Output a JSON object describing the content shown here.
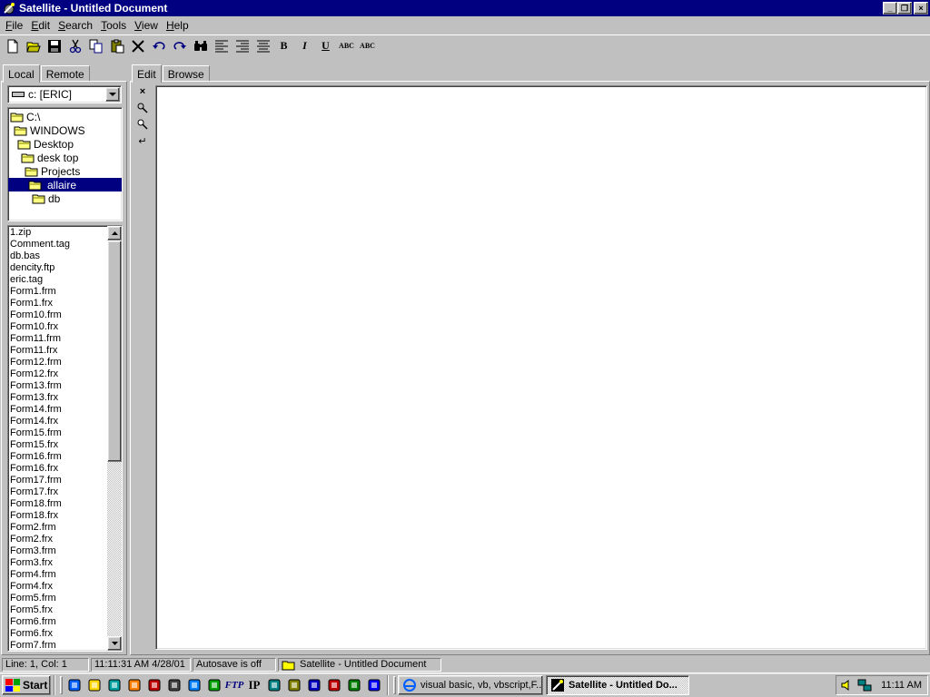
{
  "window": {
    "title": "Satellite - Untitled Document",
    "minimize_label": "_",
    "restore_label": "❐",
    "close_label": "×"
  },
  "menu": [
    {
      "label": "File",
      "hotkey": "F"
    },
    {
      "label": "Edit",
      "hotkey": "E"
    },
    {
      "label": "Search",
      "hotkey": "S"
    },
    {
      "label": "Tools",
      "hotkey": "T"
    },
    {
      "label": "View",
      "hotkey": "V"
    },
    {
      "label": "Help",
      "hotkey": "H"
    }
  ],
  "toolbar": {
    "buttons": [
      "new-icon",
      "open-icon",
      "save-icon",
      "cut-icon",
      "copy-icon",
      "paste-icon",
      "delete-icon",
      "undo-icon",
      "redo-icon",
      "find-icon",
      "align-left-icon",
      "align-right-icon",
      "align-center-icon",
      "bold-icon",
      "italic-icon",
      "underline-icon",
      "spellcheck-icon",
      "spellcheck-all-icon"
    ],
    "bold": "B",
    "italic": "I",
    "underline": "U",
    "spell1": "ABC",
    "spell2": "ABC"
  },
  "left_panel": {
    "tabs": [
      "Local",
      "Remote"
    ],
    "active_tab": "Local",
    "drive": "c: [ERIC]",
    "folders": [
      {
        "label": "C:\\",
        "indent": 0,
        "selected": false
      },
      {
        "label": "WINDOWS",
        "indent": 1,
        "selected": false
      },
      {
        "label": "Desktop",
        "indent": 2,
        "selected": false
      },
      {
        "label": "desk top",
        "indent": 3,
        "selected": false
      },
      {
        "label": "Projects",
        "indent": 4,
        "selected": false
      },
      {
        "label": "allaire",
        "indent": 5,
        "selected": true
      },
      {
        "label": "db",
        "indent": 6,
        "selected": false
      }
    ],
    "files": [
      "1.zip",
      "Comment.tag",
      "db.bas",
      "dencity.ftp",
      "eric.tag",
      "Form1.frm",
      "Form1.frx",
      "Form10.frm",
      "Form10.frx",
      "Form11.frm",
      "Form11.frx",
      "Form12.frm",
      "Form12.frx",
      "Form13.frm",
      "Form13.frx",
      "Form14.frm",
      "Form14.frx",
      "Form15.frm",
      "Form15.frx",
      "Form16.frm",
      "Form16.frx",
      "Form17.frm",
      "Form17.frx",
      "Form18.frm",
      "Form18.frx",
      "Form2.frm",
      "Form2.frx",
      "Form3.frm",
      "Form3.frx",
      "Form4.frm",
      "Form4.frx",
      "Form5.frm",
      "Form5.frx",
      "Form6.frm",
      "Form6.frx",
      "Form7.frm"
    ]
  },
  "editor_panel": {
    "tabs": [
      "Edit",
      "Browse"
    ],
    "active_tab": "Edit",
    "side_tools": [
      "close-icon",
      "tag-icon",
      "tag-edit-icon",
      "wrap-icon"
    ],
    "close_glyph": "×",
    "wrap_glyph": "↵",
    "content": ""
  },
  "status": {
    "position": "Line: 1, Col: 1",
    "timestamp": "11:11:31 AM 4/28/01",
    "autosave": "Autosave is off",
    "document": "Satellite - Untitled Document"
  },
  "taskbar": {
    "start_label": "Start",
    "quick_launch": [
      "ie-icon",
      "outlook-icon",
      "frontpage-icon",
      "winamp-icon",
      "pencil-icon",
      "drive-icon",
      "globe-icon",
      "settings-icon",
      "ftp-icon",
      "ip-icon",
      "network-icon",
      "scan-icon",
      "dialup-icon",
      "acrobat-icon",
      "excel-icon",
      "messenger-icon"
    ],
    "ftp_label": "FTP",
    "ip_label": "IP",
    "tasks": [
      {
        "label": "visual basic, vb, vbscript,F...",
        "active": false
      },
      {
        "label": "Satellite - Untitled Do...",
        "active": true
      }
    ],
    "clock": "11:11 AM"
  },
  "colors": {
    "titlebar": "#000080",
    "face": "#c0c0c0",
    "selection": "#000080"
  }
}
